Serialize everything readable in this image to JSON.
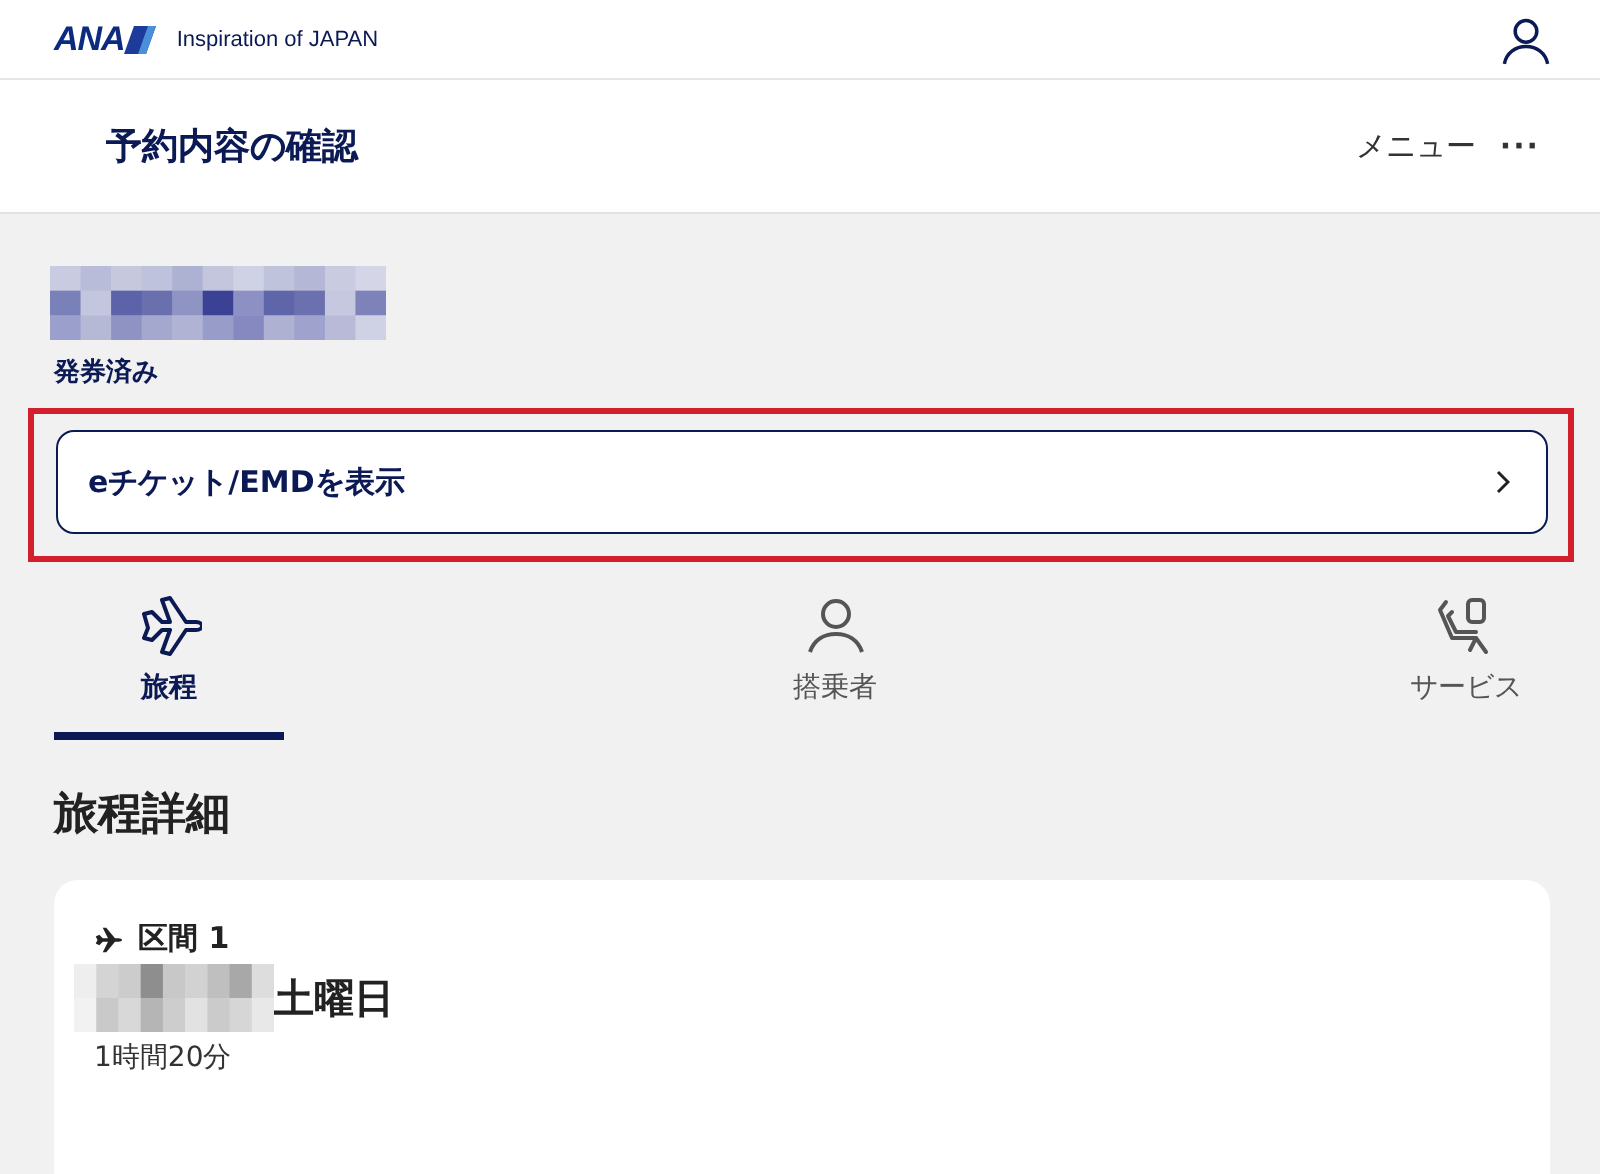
{
  "header": {
    "logo": "ANA",
    "tagline": "Inspiration of JAPAN"
  },
  "title_bar": {
    "title": "予約内容の確認",
    "menu": "メニュー",
    "more": "···"
  },
  "booking": {
    "status": "発券済み",
    "ticket_button": "eチケット/EMDを表示",
    "highlighted": true
  },
  "tabs": [
    {
      "label": "旅程",
      "kind": "flight",
      "selected": true
    },
    {
      "label": "搭乗者",
      "kind": "person",
      "selected": false
    },
    {
      "label": "サービス",
      "kind": "seat",
      "selected": false
    }
  ],
  "section_title": "旅程詳細",
  "segment": {
    "label": "区間 1",
    "date_suffix": "土曜日",
    "duration": "1時間20分"
  }
}
